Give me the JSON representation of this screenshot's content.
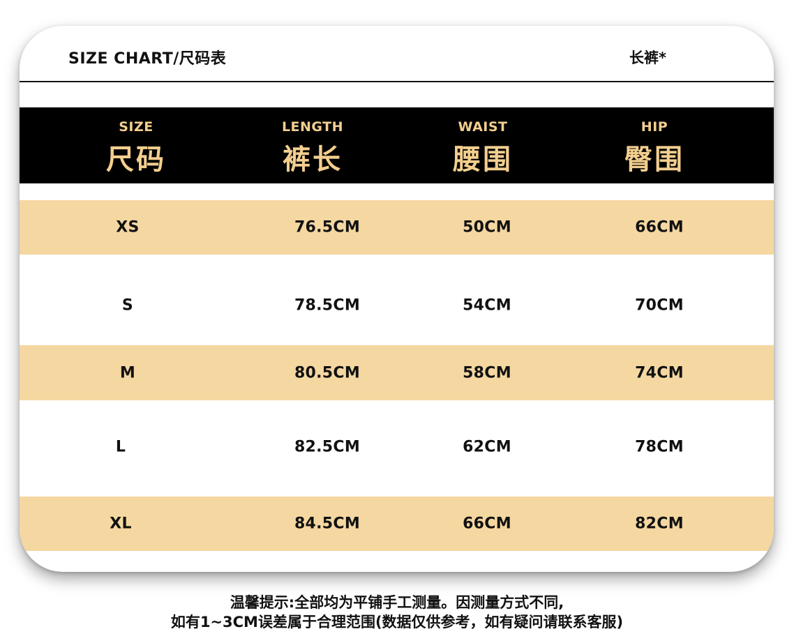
{
  "header": {
    "title": "SIZE CHART/尺码表",
    "product": "长裤*"
  },
  "columns": [
    {
      "en": "SIZE",
      "zh": "尺码"
    },
    {
      "en": "LENGTH",
      "zh": "裤长"
    },
    {
      "en": "WAIST",
      "zh": "腰围"
    },
    {
      "en": "HIP",
      "zh": "臀围"
    }
  ],
  "rows": [
    {
      "size": "XS",
      "length": "76.5CM",
      "waist": "50CM",
      "hip": "66CM"
    },
    {
      "size": "S",
      "length": "78.5CM",
      "waist": "54CM",
      "hip": "70CM"
    },
    {
      "size": "M",
      "length": "80.5CM",
      "waist": "58CM",
      "hip": "74CM"
    },
    {
      "size": "L",
      "length": "82.5CM",
      "waist": "62CM",
      "hip": "78CM"
    },
    {
      "size": "XL",
      "length": "84.5CM",
      "waist": "66CM",
      "hip": "82CM"
    }
  ],
  "note": {
    "line1": "温馨提示:全部均为平铺手工测量。因测量方式不同,",
    "line2": "如有1~3CM误差属于合理范围(数据仅供参考，如有疑问请联系客服)"
  },
  "colors": {
    "header_bg": "#000000",
    "header_text": "#f3cf8f",
    "band": "#f5d7a1"
  }
}
